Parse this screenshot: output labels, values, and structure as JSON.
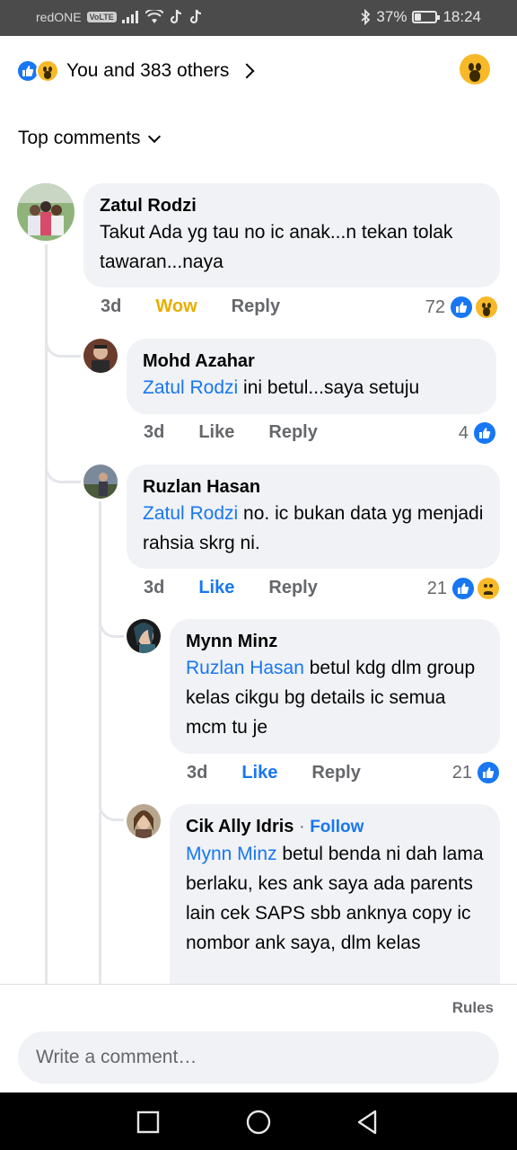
{
  "status_bar": {
    "carrier": "redONE",
    "volte": "VoLTE",
    "battery_percent": "37%",
    "battery_level": 0.37,
    "time": "18:24"
  },
  "reactions": {
    "summary": "You and 383 others"
  },
  "sort": {
    "label": "Top comments"
  },
  "comments": [
    {
      "name": "Zatul Rodzi",
      "mention": "",
      "text": "Takut Ada yg tau no ic anak...n tekan tolak tawaran...naya",
      "time": "3d",
      "like_label": "Wow",
      "reply_label": "Reply",
      "reaction_count": "72"
    },
    {
      "name": "Mohd Azahar",
      "mention": "Zatul Rodzi",
      "text": " ini betul...saya setuju",
      "time": "3d",
      "like_label": "Like",
      "reply_label": "Reply",
      "reaction_count": "4"
    },
    {
      "name": "Ruzlan Hasan",
      "mention": "Zatul Rodzi",
      "text": " no. ic bukan data yg menjadi rahsia skrg ni.",
      "time": "3d",
      "like_label": "Like",
      "reply_label": "Reply",
      "reaction_count": "21"
    },
    {
      "name": "Mynn Minz",
      "mention": "Ruzlan Hasan",
      "text": " betul kdg dlm group kelas cikgu bg details ic semua mcm tu je",
      "time": "3d",
      "like_label": "Like",
      "reply_label": "Reply",
      "reaction_count": "21"
    },
    {
      "name": "Cik Ally Idris",
      "follow": "Follow",
      "mention": "Mynn Minz",
      "text": " betul benda ni dah lama berlaku, kes ank saya ada parents lain cek SAPS sbb anknya copy ic nombor ank saya, dlm kelas"
    }
  ],
  "footer": {
    "rules": "Rules",
    "input_placeholder": "Write a comment…"
  },
  "colors": {
    "accent": "#1877f2",
    "wow": "#f7b928",
    "bubble": "#f0f2f5",
    "meta": "#65676b"
  }
}
